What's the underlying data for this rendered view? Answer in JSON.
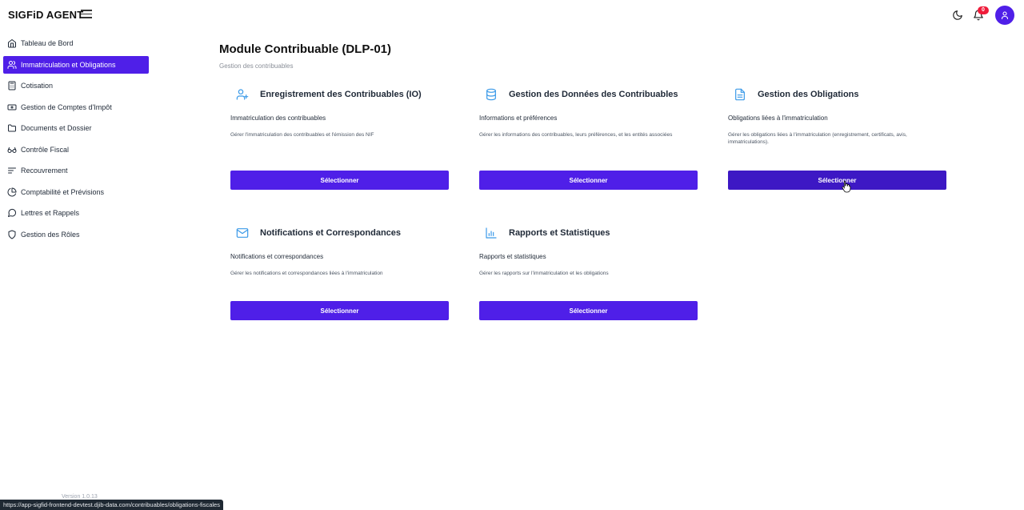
{
  "app": {
    "brand": "SIGFiD AGENT",
    "notification_count": "0",
    "version": "Version 1.0.13"
  },
  "sidebar": {
    "items": [
      {
        "label": "Tableau de Bord",
        "icon": "home-icon"
      },
      {
        "label": "Immatriculation et Obligations",
        "icon": "users-icon",
        "active": true
      },
      {
        "label": "Cotisation",
        "icon": "calculator-icon"
      },
      {
        "label": "Gestion de Comptes d'Impôt",
        "icon": "banknote-icon"
      },
      {
        "label": "Documents et Dossier",
        "icon": "folder-icon"
      },
      {
        "label": "Contrôle Fiscal",
        "icon": "glasses-icon"
      },
      {
        "label": "Recouvrement",
        "icon": "list-icon"
      },
      {
        "label": "Comptabilité et Prévisions",
        "icon": "pie-chart-icon"
      },
      {
        "label": "Lettres et Rappels",
        "icon": "message-icon"
      },
      {
        "label": "Gestion des Rôles",
        "icon": "shield-icon"
      }
    ]
  },
  "main": {
    "title": "Module Contribuable (DLP-01)",
    "subtitle": "Gestion des contribuables",
    "cards": [
      {
        "title": "Enregistrement des Contribuables (IO)",
        "subtitle": "Immatriculation des contribuables",
        "description": "Gérer l'immatriculation des contribuables et l'émission des NIF",
        "button": "Sélectionner",
        "icon": "user-plus-icon"
      },
      {
        "title": "Gestion des Données des Contribuables",
        "subtitle": "Informations et préférences",
        "description": "Gérer les informations des contribuables, leurs préférences, et les entités associées",
        "button": "Sélectionner",
        "icon": "database-icon"
      },
      {
        "title": "Gestion des Obligations",
        "subtitle": "Obligations liées à l'immatriculation",
        "description": "Gérer les obligations liées à l'immatriculation (enregistrement, certificats, avis, immatriculations).",
        "button": "Sélectionner",
        "icon": "file-text-icon"
      },
      {
        "title": "Notifications et Correspondances",
        "subtitle": "Notifications et correspondances",
        "description": "Gérer les notifications et correspondances liées à l'immatriculation",
        "button": "Sélectionner",
        "icon": "mail-icon"
      },
      {
        "title": "Rapports et Statistiques",
        "subtitle": "Rapports et statistiques",
        "description": "Gérer les rapports sur l'immatriculation et les obligations",
        "button": "Sélectionner",
        "icon": "bar-chart-icon"
      }
    ]
  },
  "statusbar": {
    "url": "https://app-sigfid-frontend-devtest.djib-data.com/contribuables/obligations-fiscales"
  },
  "colors": {
    "accent": "#4f1fe8",
    "icon_blue": "#3b9ae8",
    "badge": "#ef1c3a"
  }
}
